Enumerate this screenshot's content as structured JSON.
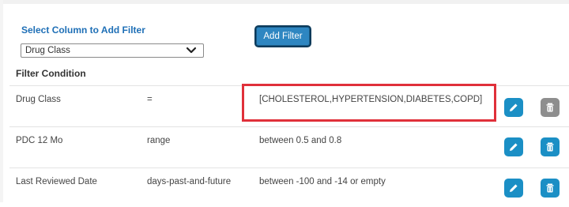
{
  "filter_form": {
    "select_label": "Select Column to Add Filter",
    "selected_column": "Drug Class",
    "add_button": "Add Filter"
  },
  "conditions": {
    "heading": "Filter Condition",
    "rows": [
      {
        "column": "Drug Class",
        "operator": "=",
        "value": "[CHOLESTEROL,HYPERTENSION,DIABETES,COPD]",
        "delete_disabled": true
      },
      {
        "column": "PDC 12 Mo",
        "operator": "range",
        "value": "between 0.5 and 0.8",
        "delete_disabled": false
      },
      {
        "column": "Last Reviewed Date",
        "operator": "days-past-and-future",
        "value": "between -100 and -14 or empty",
        "delete_disabled": false
      }
    ]
  },
  "icons": {
    "edit": "pencil-icon",
    "delete": "trash-icon",
    "dropdown": "chevron-down-icon"
  },
  "colors": {
    "accent": "#1b8fc5",
    "label_blue": "#1e6fb6",
    "highlight": "#e0303a",
    "disabled": "#8e8e8e"
  }
}
